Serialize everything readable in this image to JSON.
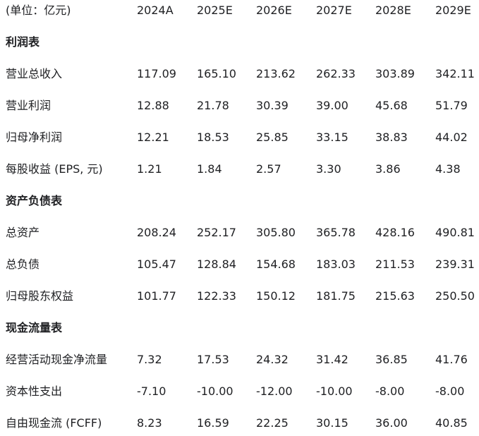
{
  "header": {
    "unit_label": "(单位：亿元)",
    "years": [
      "2024A",
      "2025E",
      "2026E",
      "2027E",
      "2028E",
      "2029E"
    ]
  },
  "sections": [
    {
      "title": "利润表",
      "rows": [
        {
          "label": "营业总收入",
          "values": [
            "117.09",
            "165.10",
            "213.62",
            "262.33",
            "303.89",
            "342.11"
          ]
        },
        {
          "label": "营业利润",
          "values": [
            "12.88",
            "21.78",
            "30.39",
            "39.00",
            "45.68",
            "51.79"
          ]
        },
        {
          "label": "归母净利润",
          "values": [
            "12.21",
            "18.53",
            "25.85",
            "33.15",
            "38.83",
            "44.02"
          ]
        },
        {
          "label": "每股收益 (EPS, 元)",
          "values": [
            "1.21",
            "1.84",
            "2.57",
            "3.30",
            "3.86",
            "4.38"
          ]
        }
      ]
    },
    {
      "title": "资产负债表",
      "rows": [
        {
          "label": "总资产",
          "values": [
            "208.24",
            "252.17",
            "305.80",
            "365.78",
            "428.16",
            "490.81"
          ]
        },
        {
          "label": "总负债",
          "values": [
            "105.47",
            "128.84",
            "154.68",
            "183.03",
            "211.53",
            "239.31"
          ]
        },
        {
          "label": "归母股东权益",
          "values": [
            "101.77",
            "122.33",
            "150.12",
            "181.75",
            "215.63",
            "250.50"
          ]
        }
      ]
    },
    {
      "title": "现金流量表",
      "rows": [
        {
          "label": "经营活动现金净流量",
          "values": [
            "7.32",
            "17.53",
            "24.32",
            "31.42",
            "36.85",
            "41.76"
          ]
        },
        {
          "label": "资本性支出",
          "values": [
            "-7.10",
            "-10.00",
            "-12.00",
            "-10.00",
            "-8.00",
            "-8.00"
          ]
        },
        {
          "label": "自由现金流 (FCFF)",
          "values": [
            "8.23",
            "16.59",
            "22.25",
            "30.15",
            "36.00",
            "40.85"
          ]
        }
      ]
    }
  ]
}
